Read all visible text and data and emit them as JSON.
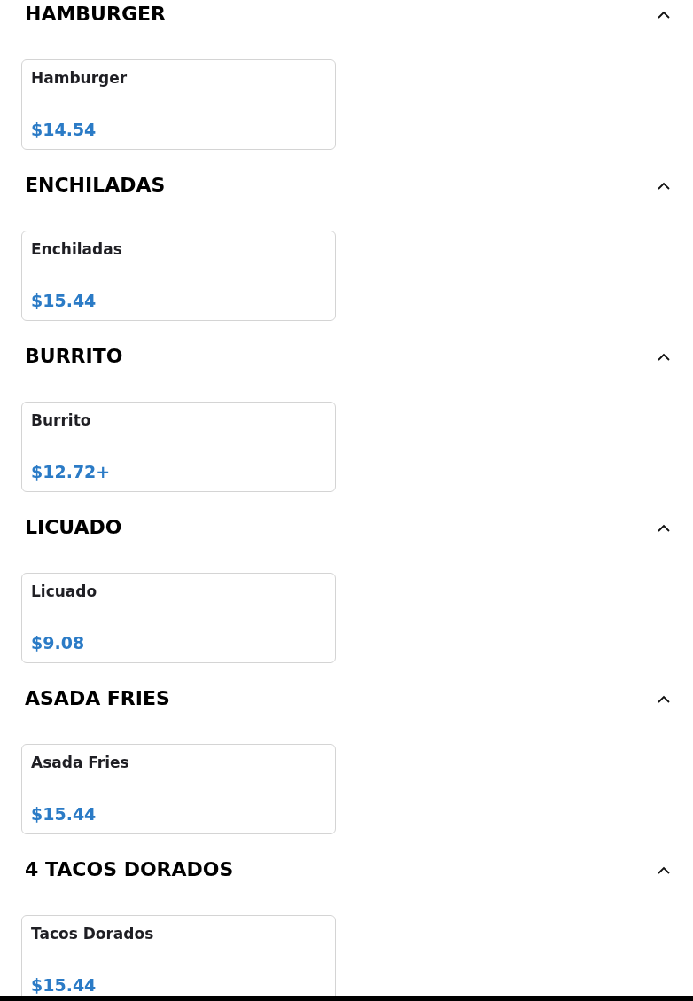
{
  "categories": [
    {
      "title": "HAMBURGER",
      "expanded": true,
      "items": [
        {
          "name": "Hamburger",
          "price": "$14.54"
        }
      ]
    },
    {
      "title": "ENCHILADAS",
      "expanded": true,
      "items": [
        {
          "name": "Enchiladas",
          "price": "$15.44"
        }
      ]
    },
    {
      "title": "BURRITO",
      "expanded": true,
      "items": [
        {
          "name": "Burrito",
          "price": "$12.72+"
        }
      ]
    },
    {
      "title": "LICUADO",
      "expanded": true,
      "items": [
        {
          "name": "Licuado",
          "price": "$9.08"
        }
      ]
    },
    {
      "title": "ASADA FRIES",
      "expanded": true,
      "items": [
        {
          "name": "Asada Fries",
          "price": "$15.44"
        }
      ]
    },
    {
      "title": "4 TACOS DORADOS",
      "expanded": true,
      "items": [
        {
          "name": "Tacos Dorados",
          "price": "$15.44"
        }
      ]
    }
  ]
}
